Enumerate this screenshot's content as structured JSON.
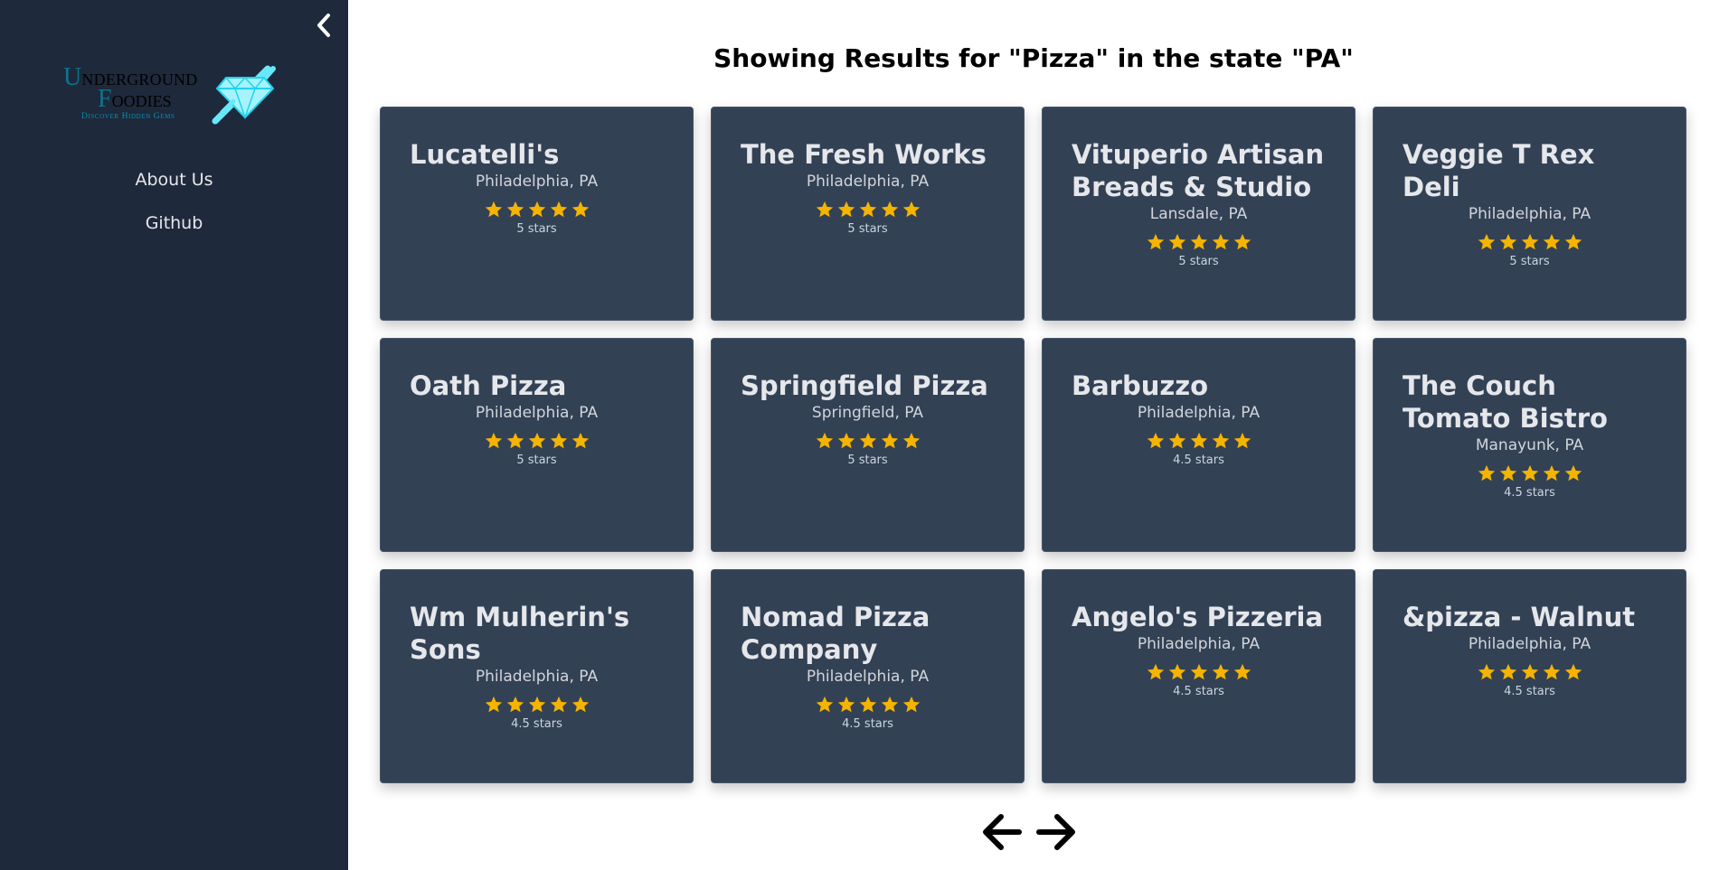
{
  "sidebar": {
    "logo": {
      "line1": "UNDERGROUND",
      "line2": "FOODIES",
      "tagline": "Discover Hidden Gems"
    },
    "nav": [
      {
        "label": "About Us"
      },
      {
        "label": "Github"
      }
    ]
  },
  "main": {
    "title": "Showing Results for \"Pizza\" in the state \"PA\""
  },
  "star_color": "#f4b400",
  "results": [
    {
      "name": "Lucatelli's",
      "location": "Philadelphia, PA",
      "rating": 5,
      "rating_label": "5 stars"
    },
    {
      "name": "The Fresh Works",
      "location": "Philadelphia, PA",
      "rating": 5,
      "rating_label": "5 stars"
    },
    {
      "name": "Vituperio Artisan Breads & Studio",
      "location": "Lansdale, PA",
      "rating": 5,
      "rating_label": "5 stars"
    },
    {
      "name": "Veggie T Rex Deli",
      "location": "Philadelphia, PA",
      "rating": 5,
      "rating_label": "5 stars"
    },
    {
      "name": "Oath Pizza",
      "location": "Philadelphia, PA",
      "rating": 5,
      "rating_label": "5 stars"
    },
    {
      "name": "Springfield Pizza",
      "location": "Springfield, PA",
      "rating": 5,
      "rating_label": "5 stars"
    },
    {
      "name": "Barbuzzo",
      "location": "Philadelphia, PA",
      "rating": 4.5,
      "rating_label": "4.5 stars"
    },
    {
      "name": "The Couch Tomato Bistro",
      "location": "Manayunk, PA",
      "rating": 4.5,
      "rating_label": "4.5 stars"
    },
    {
      "name": "Wm Mulherin's Sons",
      "location": "Philadelphia, PA",
      "rating": 4.5,
      "rating_label": "4.5 stars"
    },
    {
      "name": "Nomad Pizza Company",
      "location": "Philadelphia, PA",
      "rating": 4.5,
      "rating_label": "4.5 stars"
    },
    {
      "name": "Angelo's Pizzeria",
      "location": "Philadelphia, PA",
      "rating": 4.5,
      "rating_label": "4.5 stars"
    },
    {
      "name": "&pizza - Walnut",
      "location": "Philadelphia, PA",
      "rating": 4.5,
      "rating_label": "4.5 stars"
    }
  ],
  "icons": {
    "collapse": "chevron-left-icon",
    "prev": "arrow-left-icon",
    "next": "arrow-right-icon",
    "star": "star-icon"
  }
}
